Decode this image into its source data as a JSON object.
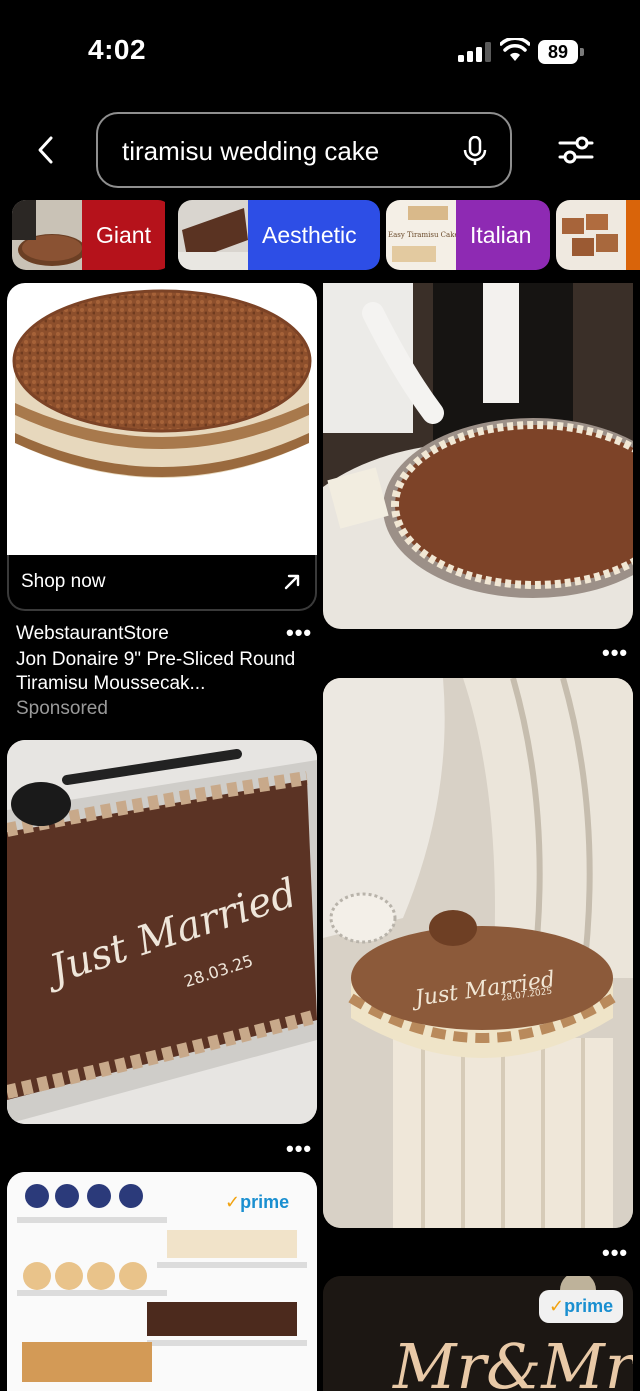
{
  "status_bar": {
    "time": "4:02",
    "battery": "89"
  },
  "search": {
    "query": "tiramisu wedding cake"
  },
  "chips": [
    {
      "label": "Giant",
      "color": "#b5121b"
    },
    {
      "label": "Aesthetic",
      "color": "#2d4ee6"
    },
    {
      "label": "Italian",
      "color": "#8e2ab3"
    }
  ],
  "chip_thumb_text": "Easy Tiramisu Cake",
  "sponsored_pin": {
    "cta": "Shop now",
    "store": "WebstaurantStore",
    "title": "Jon Donaire 9\" Pre-Sliced Round Tiramisu Moussecak...",
    "sponsored": "Sponsored"
  },
  "cake_writing": {
    "script": "Just Married",
    "date": "28.03.25",
    "date_small": "28.07.2025"
  },
  "badges": {
    "prime": "prime",
    "prime_check": "✓"
  },
  "more": "•••",
  "sign_text": "Mr&Mrs"
}
